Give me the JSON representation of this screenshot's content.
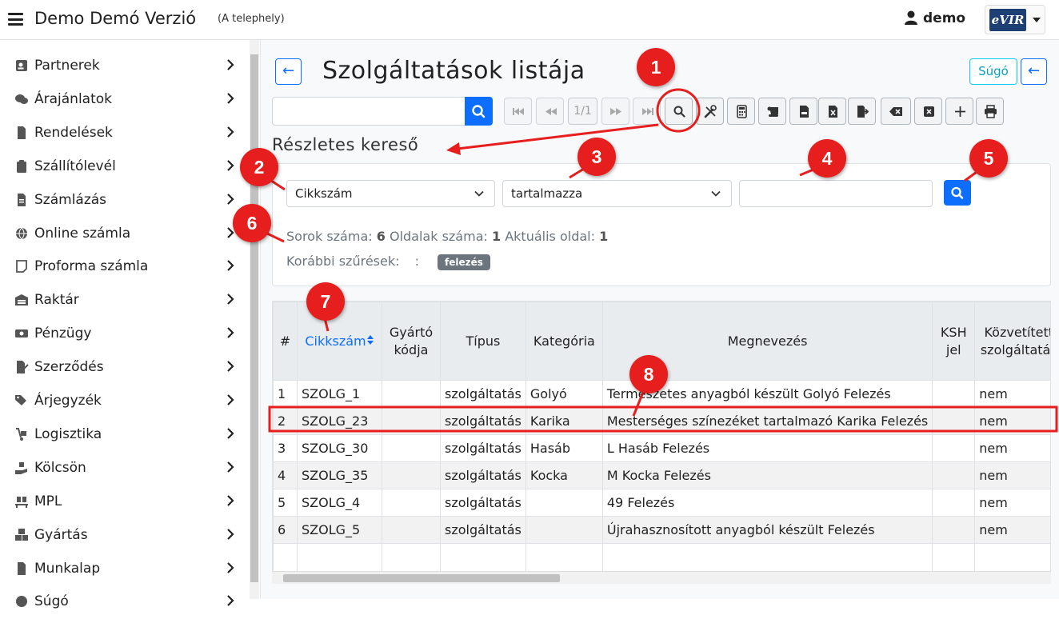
{
  "header": {
    "app_title": "Demo Demó Verzió",
    "site": "(A telephely)",
    "user": "demo",
    "logo_text": "eVIR"
  },
  "sidebar": {
    "items": [
      {
        "label": "Partnerek",
        "icon": "address-card-icon"
      },
      {
        "label": "Árajánlatok",
        "icon": "comments-icon"
      },
      {
        "label": "Rendelések",
        "icon": "file-icon"
      },
      {
        "label": "Szállítólevél",
        "icon": "clipboard-icon"
      },
      {
        "label": "Számlázás",
        "icon": "file-invoice-icon"
      },
      {
        "label": "Online számla",
        "icon": "globe-icon"
      },
      {
        "label": "Proforma számla",
        "icon": "sticky-note-icon"
      },
      {
        "label": "Raktár",
        "icon": "warehouse-icon"
      },
      {
        "label": "Pénzügy",
        "icon": "money-icon"
      },
      {
        "label": "Szerződés",
        "icon": "file-signature-icon"
      },
      {
        "label": "Árjegyzék",
        "icon": "tags-icon"
      },
      {
        "label": "Logisztika",
        "icon": "dolly-icon"
      },
      {
        "label": "Kölcsön",
        "icon": "hand-holding-icon"
      },
      {
        "label": "MPL",
        "icon": "pallet-icon"
      },
      {
        "label": "Gyártás",
        "icon": "cubes-icon"
      },
      {
        "label": "Munkalap",
        "icon": "file-alt-icon"
      },
      {
        "label": "Súgó",
        "icon": "question-icon"
      }
    ]
  },
  "page": {
    "title": "Szolgáltatások listája",
    "help_label": "Súgó",
    "back_glyph": "←",
    "page_indicator": "1/1"
  },
  "search": {
    "section_title": "Részletes kereső",
    "field_select": "Cikkszám",
    "operator_select": "tartalmazza",
    "value": "",
    "stats": {
      "rows_label": "Sorok száma:",
      "rows": "6",
      "pages_label": "Oldalak száma:",
      "pages": "1",
      "current_label": "Aktuális oldal:",
      "current": "1"
    },
    "previous_filters_label": "Korábbi szűrések:",
    "previous_filter_sep": ":",
    "previous_filter": "felezés"
  },
  "table": {
    "columns": [
      "#",
      "Cikkszám",
      "Gyártó kódja",
      "Típus",
      "Kategória",
      "Megnevezés",
      "KSH jel",
      "Közvetített szolgáltatás"
    ],
    "column_lines": [
      [
        "#"
      ],
      [
        "Cikkszám"
      ],
      [
        "Gyártó",
        "kódja"
      ],
      [
        "Típus"
      ],
      [
        "Kategória"
      ],
      [
        "Megnevezés"
      ],
      [
        "KSH",
        "jel"
      ],
      [
        "Közvetített",
        "szolgáltatás"
      ]
    ],
    "rows": [
      [
        "1",
        "SZOLG_1",
        "",
        "szolgáltatás",
        "Golyó",
        "Természetes anyagból készült Golyó Felezés",
        "",
        "nem"
      ],
      [
        "2",
        "SZOLG_23",
        "",
        "szolgáltatás",
        "Karika",
        "Mesterséges színezéket tartalmazó Karika Felezés",
        "",
        "nem"
      ],
      [
        "3",
        "SZOLG_30",
        "",
        "szolgáltatás",
        "Hasáb",
        "L Hasáb Felezés",
        "",
        "nem"
      ],
      [
        "4",
        "SZOLG_35",
        "",
        "szolgáltatás",
        "Kocka",
        "M Kocka Felezés",
        "",
        "nem"
      ],
      [
        "5",
        "SZOLG_4",
        "",
        "szolgáltatás",
        "",
        "49 Felezés",
        "",
        "nem"
      ],
      [
        "6",
        "SZOLG_5",
        "",
        "szolgáltatás",
        "",
        "Újrahasznosított anyagból készült Felezés",
        "",
        "nem"
      ]
    ]
  },
  "annotations": [
    "1",
    "2",
    "3",
    "4",
    "5",
    "6",
    "7",
    "8"
  ],
  "colors": {
    "primary": "#0d6efd",
    "annotation_red": "#e61e1e",
    "help_cyan": "#0dcaf0"
  }
}
